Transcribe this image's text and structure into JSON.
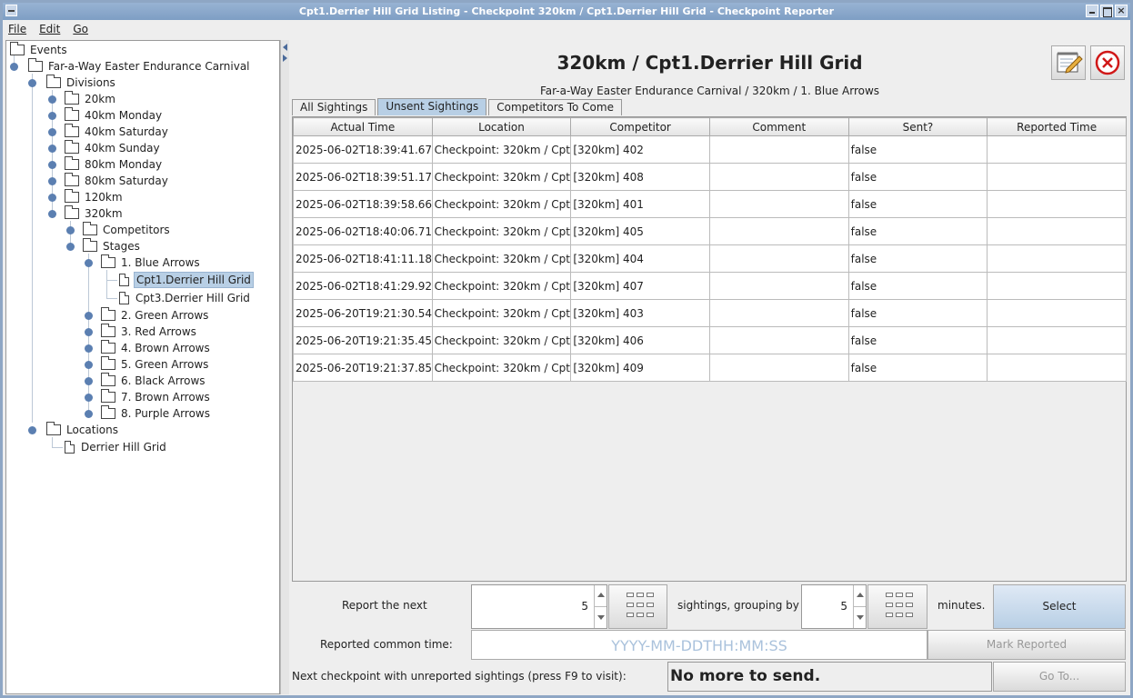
{
  "window": {
    "title": "Cpt1.Derrier Hill Grid Listing - Checkpoint 320km / Cpt1.Derrier Hill Grid - Checkpoint Reporter"
  },
  "menu": {
    "file": "File",
    "edit": "Edit",
    "go": "Go"
  },
  "tree": {
    "events": "Events",
    "carnival": "Far-a-Way Easter Endurance Carnival",
    "divisions": "Divisions",
    "div_20km": "20km",
    "div_40km_monday": "40km Monday",
    "div_40km_saturday": "40km Saturday",
    "div_40km_sunday": "40km Sunday",
    "div_80km_monday": "80km Monday",
    "div_80km_saturday": "80km Saturday",
    "div_120km": "120km",
    "div_320km": "320km",
    "competitors": "Competitors",
    "stages": "Stages",
    "stage_1": "1. Blue Arrows",
    "cpt1": "Cpt1.Derrier Hill Grid",
    "cpt3": "Cpt3.Derrier Hill Grid",
    "stage_2": "2. Green Arrows",
    "stage_3": "3. Red Arrows",
    "stage_4": "4. Brown Arrows",
    "stage_5": "5. Green Arrows",
    "stage_6": "6. Black Arrows",
    "stage_7": "7. Brown Arrows",
    "stage_8": "8. Purple Arrows",
    "locations": "Locations",
    "loc_derrier": "Derrier Hill Grid"
  },
  "header": {
    "title": "320km / Cpt1.Derrier Hill Grid",
    "subtitle": "Far-a-Way Easter Endurance Carnival / 320km / 1. Blue Arrows"
  },
  "tabs": {
    "all": "All Sightings",
    "unsent": "Unsent Sightings",
    "to_come": "Competitors To Come"
  },
  "table": {
    "columns": [
      "Actual Time",
      "Location",
      "Competitor",
      "Comment",
      "Sent?",
      "Reported Time"
    ],
    "rows": [
      [
        "2025-06-02T18:39:41.67...",
        "Checkpoint: 320km / Cpt1...",
        "[320km] 402",
        "",
        "false",
        ""
      ],
      [
        "2025-06-02T18:39:51.17...",
        "Checkpoint: 320km / Cpt1...",
        "[320km] 408",
        "",
        "false",
        ""
      ],
      [
        "2025-06-02T18:39:58.66...",
        "Checkpoint: 320km / Cpt1...",
        "[320km] 401",
        "",
        "false",
        ""
      ],
      [
        "2025-06-02T18:40:06.71...",
        "Checkpoint: 320km / Cpt1...",
        "[320km] 405",
        "",
        "false",
        ""
      ],
      [
        "2025-06-02T18:41:11.18...",
        "Checkpoint: 320km / Cpt1...",
        "[320km] 404",
        "",
        "false",
        ""
      ],
      [
        "2025-06-02T18:41:29.92...",
        "Checkpoint: 320km / Cpt1...",
        "[320km] 407",
        "",
        "false",
        ""
      ],
      [
        "2025-06-20T19:21:30.54...",
        "Checkpoint: 320km / Cpt1...",
        "[320km] 403",
        "",
        "false",
        ""
      ],
      [
        "2025-06-20T19:21:35.45...",
        "Checkpoint: 320km / Cpt1...",
        "[320km] 406",
        "",
        "false",
        ""
      ],
      [
        "2025-06-20T19:21:37.85...",
        "Checkpoint: 320km / Cpt1...",
        "[320km] 409",
        "",
        "false",
        ""
      ]
    ]
  },
  "controls": {
    "report_next_label": "Report the next",
    "report_count": "5",
    "grouping_label": "sightings, grouping by",
    "grouping_value": "5",
    "minutes_label": "minutes.",
    "select_button": "Select",
    "common_time_label": "Reported common time:",
    "common_time_placeholder": "YYYY-MM-DDTHH:MM:SS",
    "mark_reported_button": "Mark Reported",
    "next_checkpoint_label": "Next checkpoint with unreported sightings (press F9 to visit):",
    "status_text": "No more to send.",
    "goto_button": "Go To..."
  }
}
